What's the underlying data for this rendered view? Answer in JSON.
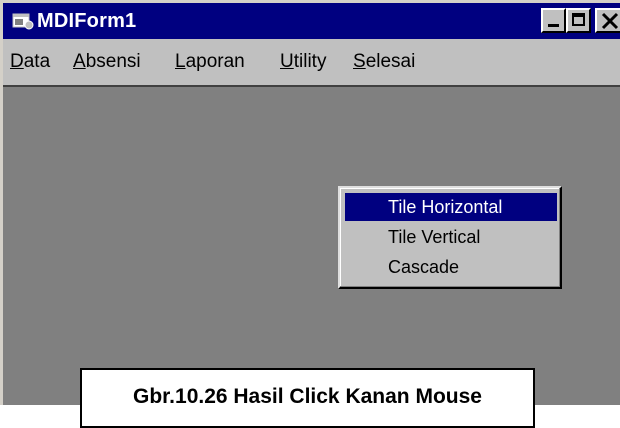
{
  "window": {
    "title": "MDIForm1",
    "icon": "form-app-icon",
    "controls": {
      "minimize_icon": "minimize-icon",
      "maximize_icon": "maximize-icon",
      "close_icon": "close-icon"
    }
  },
  "menubar": {
    "items": [
      {
        "accel": "D",
        "rest": "ata"
      },
      {
        "accel": "A",
        "rest": "bsensi"
      },
      {
        "accel": "L",
        "rest": "aporan"
      },
      {
        "accel": "U",
        "rest": "tility"
      },
      {
        "accel": "S",
        "rest": "elesai"
      }
    ]
  },
  "context_menu": {
    "items": [
      {
        "label": "Tile Horizontal",
        "selected": true
      },
      {
        "label": "Tile Vertical",
        "selected": false
      },
      {
        "label": "Cascade",
        "selected": false
      }
    ]
  },
  "figure_caption": "Gbr.10.26 Hasil Click Kanan Mouse",
  "colors": {
    "titlebar": "#000080",
    "face": "#c0c0c0",
    "mdi_background": "#808080",
    "highlight": "#000080"
  }
}
